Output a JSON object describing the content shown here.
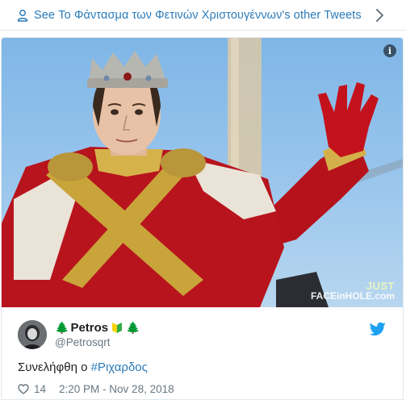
{
  "topbar": {
    "label": "See Το Φάντασμα των Φετινών Χριστουγέννων's other Tweets",
    "icon": "person-icon",
    "chevron_icon": "chevron-right-icon"
  },
  "media": {
    "description_icon": "info-icon",
    "info_glyph": "i",
    "watermark_top": "JUST",
    "watermark_bottom": "FACEinHOLE.com"
  },
  "author": {
    "name_prefix_emoji": "🌲",
    "name": "Petros",
    "badge_icon": "beginner-badge-icon",
    "name_suffix_emoji": "🌲",
    "handle": "@Petrosqrt"
  },
  "tweet": {
    "text": "Συνελήφθη ο ",
    "hashtag": "#Ριχαρδος",
    "likes": "14",
    "timestamp": "2:20 PM - Nov 28, 2018"
  },
  "colors": {
    "link": "#2b7bb9",
    "muted": "#697882",
    "twitter_blue": "#1da1f2",
    "border": "#e1e8ed"
  }
}
